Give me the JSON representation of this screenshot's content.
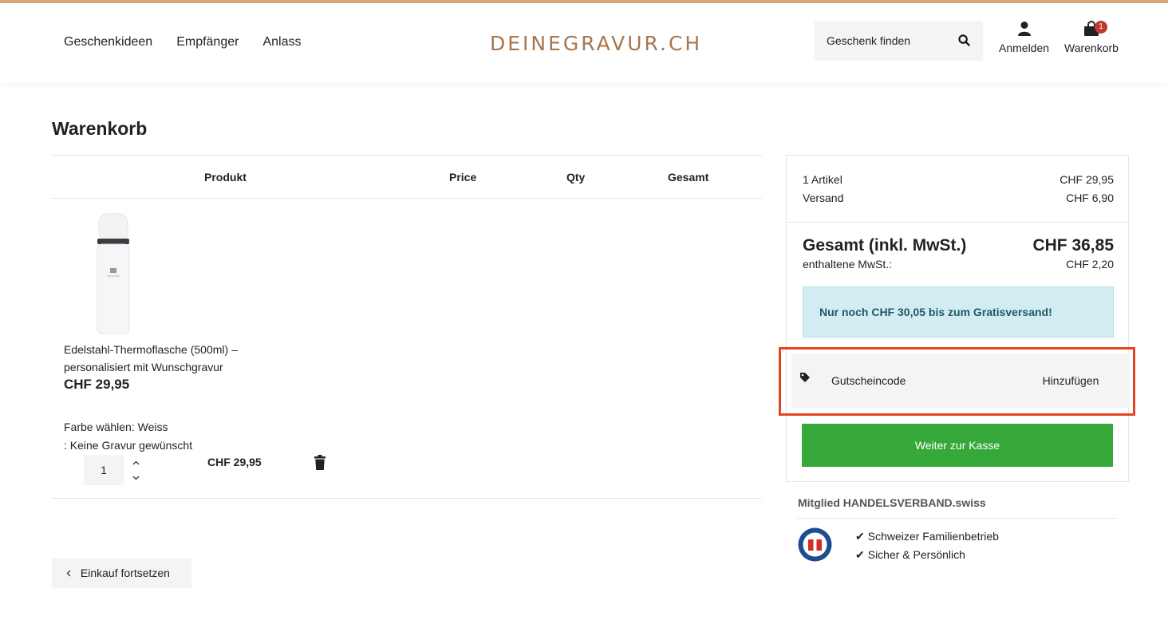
{
  "header": {
    "nav": [
      "Geschenkideen",
      "Empfänger",
      "Anlass"
    ],
    "logo": "DEINEGRAVUR.CH",
    "search_placeholder": "Geschenk finden",
    "login_label": "Anmelden",
    "cart_label": "Warenkorb",
    "cart_count": "1"
  },
  "page_title": "Warenkorb",
  "table": {
    "headers": [
      "Produkt",
      "Price",
      "Qty",
      "Gesamt"
    ]
  },
  "item": {
    "name": "Edelstahl-Thermoflasche (500ml) – personalisiert mit Wunschgravur",
    "price": "CHF 29,95",
    "option1": "Farbe wählen: Weiss",
    "option2": ": Keine Gravur gewünscht",
    "qty": "1",
    "total": "CHF 29,95"
  },
  "continue_label": "Einkauf fortsetzen",
  "summary": {
    "articles_label": "1 Artikel",
    "articles_value": "CHF 29,95",
    "shipping_label": "Versand",
    "shipping_value": "CHF 6,90",
    "total_label": "Gesamt (inkl. MwSt.)",
    "total_value": "CHF 36,85",
    "vat_label": "enthaltene MwSt.:",
    "vat_value": "CHF 2,20",
    "free_shipping": "Nur noch CHF 30,05 bis zum Gratisversand!",
    "voucher_placeholder": "Gutscheincode",
    "voucher_add": "Hinzufügen",
    "checkout_label": "Weiter zur Kasse"
  },
  "trust": {
    "member": "Mitglied HANDELSVERBAND.swiss",
    "points": [
      "Schweizer Familienbetrieb",
      "Sicher & Persönlich"
    ]
  },
  "colors": {
    "accent": "#d9a77c",
    "logo": "#a8764d",
    "checkout": "#35a839",
    "info_bg": "#d2ecf1",
    "highlight": "#e8431f"
  }
}
